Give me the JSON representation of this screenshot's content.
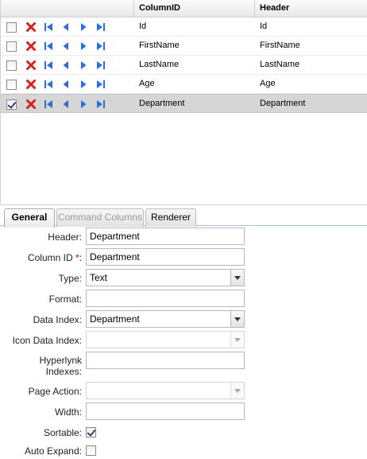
{
  "grid": {
    "columns": [
      "ColumnID",
      "Header"
    ],
    "rows": [
      {
        "column_id": "Id",
        "header": "Id",
        "checked": false
      },
      {
        "column_id": "FirstName",
        "header": "FirstName",
        "checked": false
      },
      {
        "column_id": "LastName",
        "header": "LastName",
        "checked": false
      },
      {
        "column_id": "Age",
        "header": "Age",
        "checked": false
      },
      {
        "column_id": "Department",
        "header": "Department",
        "checked": true
      }
    ],
    "selected_row": "Department"
  },
  "tabs": [
    {
      "label": "General",
      "state": "active"
    },
    {
      "label": "Command Columns",
      "state": "disabled"
    },
    {
      "label": "Renderer",
      "state": "normal"
    }
  ],
  "form": {
    "header": {
      "label": "Header:",
      "value": "Department"
    },
    "column_id": {
      "label": "Column ID",
      "required_mark": "*",
      "label_suffix": ":",
      "value": "Department"
    },
    "type": {
      "label": "Type:",
      "value": "Text"
    },
    "format": {
      "label": "Format:",
      "value": ""
    },
    "data_index": {
      "label": "Data Index:",
      "value": "Department"
    },
    "icon_data_index": {
      "label": "Icon Data Index:",
      "value": ""
    },
    "hyperlink_indexes": {
      "label_line1": "Hyperlynk",
      "label_line2": "Indexes:",
      "value": ""
    },
    "page_action": {
      "label": "Page Action:",
      "value": ""
    },
    "width": {
      "label": "Width:",
      "value": ""
    },
    "sortable": {
      "label": "Sortable:",
      "checked": true
    },
    "auto_expand": {
      "label": "Auto Expand:",
      "checked": false
    }
  },
  "icons": {
    "delete": "delete-x-icon",
    "move_first": "move-first-icon",
    "move_up": "move-up-icon",
    "move_down": "move-down-icon",
    "move_last": "move-last-icon"
  },
  "colors": {
    "delete_red": "#d9201c",
    "nav_blue": "#2f6fd4",
    "selected_row": "#d6d6d6",
    "required": "#dd0000"
  }
}
